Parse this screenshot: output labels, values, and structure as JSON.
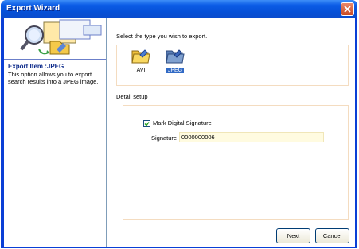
{
  "window": {
    "title": "Export Wizard"
  },
  "left": {
    "export_item_label": "Export Item :JPEG",
    "description": "This option allows you to export search results into a JPEG image."
  },
  "main": {
    "prompt": "Select the type you wish to export.",
    "types": [
      {
        "label": "AVI",
        "icon": "avi-folder-icon",
        "selected": false
      },
      {
        "label": "JPEG",
        "icon": "jpeg-folder-icon",
        "selected": true
      }
    ],
    "detail_heading": "Detail setup",
    "mark_signature_label": "Mark Digital Signature",
    "mark_signature_checked": true,
    "signature_label": "Signature",
    "signature_value": "0000000006"
  },
  "buttons": {
    "next": "Next",
    "cancel": "Cancel"
  },
  "colors": {
    "titlebar": "#0650d6",
    "selection": "#316ac5",
    "close": "#c94a22"
  }
}
